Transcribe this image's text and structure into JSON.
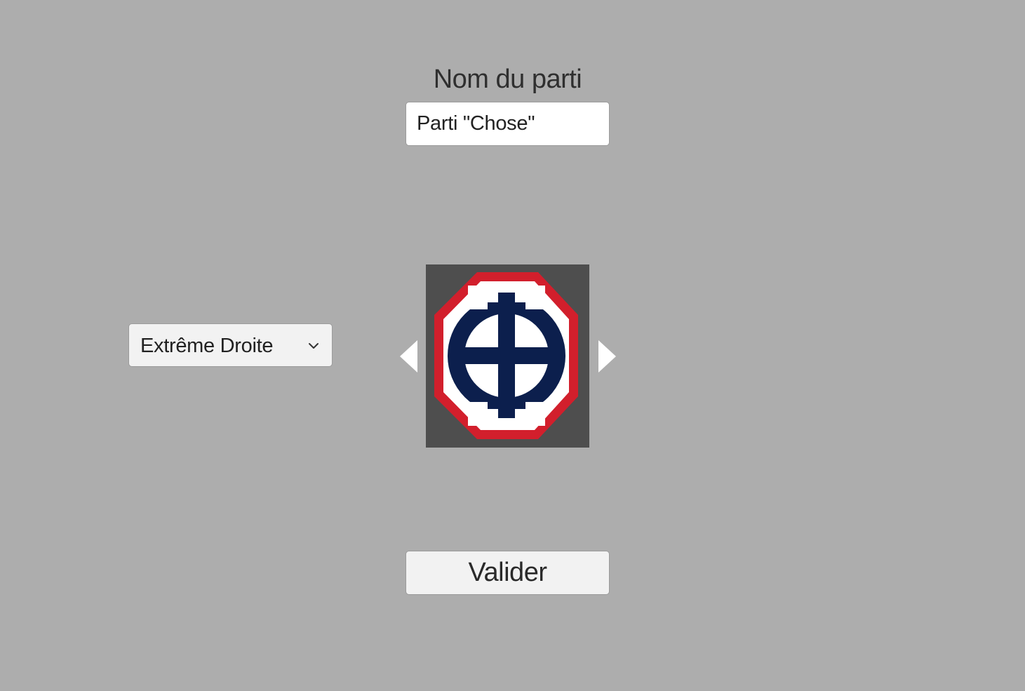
{
  "party_name": {
    "label": "Nom du parti",
    "value": "Parti \"Chose\""
  },
  "orientation": {
    "selected": "Extrême Droite",
    "icon": "chevron-down-icon"
  },
  "logo": {
    "description_icon": "party-emblem",
    "colors": {
      "frame": "#4e4e4e",
      "octagon_border": "#d21f2c",
      "octagon_fill": "#ffffff",
      "emblem": "#0c1f4d"
    },
    "prev_icon": "arrow-left-icon",
    "next_icon": "arrow-right-icon"
  },
  "actions": {
    "validate_label": "Valider"
  },
  "theme": {
    "background": "#adadad"
  }
}
